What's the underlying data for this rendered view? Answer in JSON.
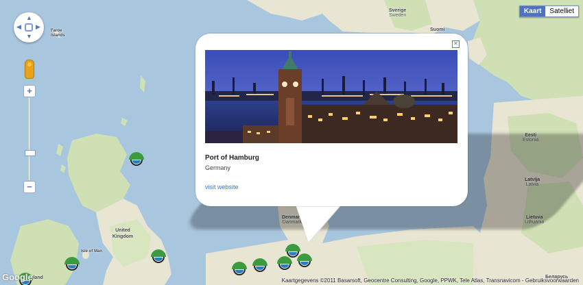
{
  "map_type": {
    "active": "Kaart",
    "inactive": "Satelliet"
  },
  "labels": {
    "sweden": {
      "name": "Sverige",
      "native": "Sweden"
    },
    "faroe": {
      "name": "Faroe Islands"
    },
    "united_kingdom": {
      "name": "United Kingdom"
    },
    "isle_of_man": {
      "name": "Isle of Man"
    },
    "ireland": {
      "name": "Ireland"
    },
    "denmark": {
      "name": "Denmark",
      "native": "Danmark"
    },
    "estonia": {
      "name": "Eesti",
      "native": "Estonia"
    },
    "latvia": {
      "name": "Latvija",
      "native": "Latvia"
    },
    "lithuania": {
      "name": "Lietuva",
      "native": "Lithuania"
    },
    "belarus": {
      "name": "Беларусь"
    },
    "finland_partial": {
      "name": "Suomi"
    }
  },
  "info_window": {
    "title": "Port of Hamburg",
    "subtitle": "Germany",
    "link": "visit website",
    "close_icon": "close-icon"
  },
  "logo": "Google",
  "attribution": "Kaartgegevens ©2011 Basarsoft, Geocentre Consulting, Google, PPWK, Tele Atlas, Transnavicom - Gebruiksvoorwaarden",
  "colors": {
    "water": "#a9c6df",
    "land": "#e8e4d2",
    "forest": "#cfe0b5",
    "marker_green": "#3b9b3e",
    "link": "#3b78c4",
    "control_blue": "#4f72bf"
  },
  "icons": [
    "pan-control-icon",
    "pegman-icon",
    "zoom-in-icon",
    "zoom-out-icon",
    "port-marker-icon"
  ]
}
